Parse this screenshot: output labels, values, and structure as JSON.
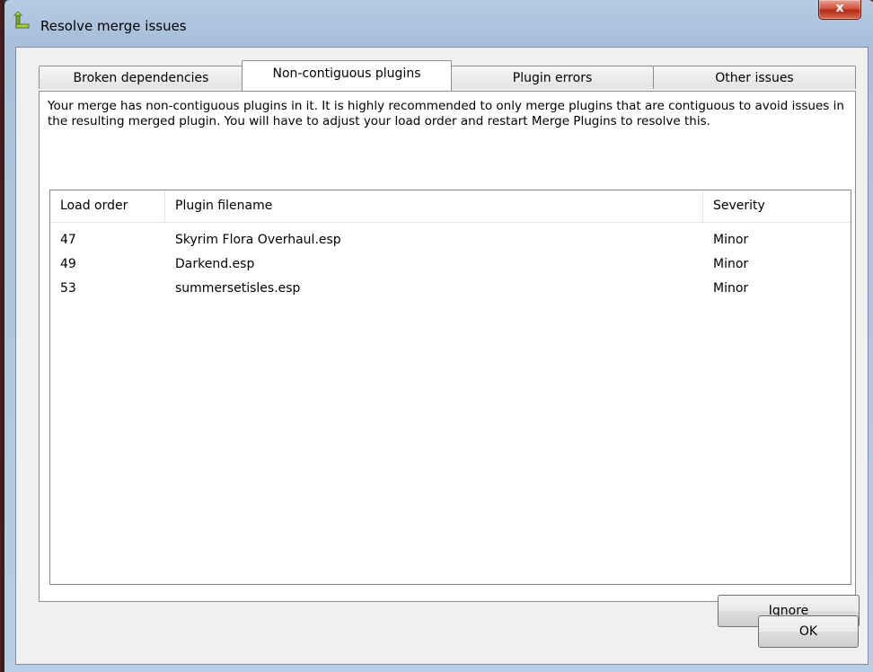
{
  "window": {
    "title": "Resolve merge issues",
    "close_label": "x"
  },
  "tabs": [
    {
      "label": "Broken dependencies",
      "active": false
    },
    {
      "label": "Non-contiguous plugins",
      "active": true
    },
    {
      "label": "Plugin errors",
      "active": false
    },
    {
      "label": "Other issues",
      "active": false
    }
  ],
  "panel": {
    "description": "Your merge has non-contiguous plugins in it.  It is highly recommended to only merge plugins that are contiguous to avoid issues in the resulting merged plugin.  You will have to adjust your load order and restart Merge Plugins to resolve this.",
    "columns": [
      "Load order",
      "Plugin filename",
      "Severity"
    ],
    "rows": [
      {
        "load_order": "47",
        "filename": "Skyrim Flora Overhaul.esp",
        "severity": "Minor"
      },
      {
        "load_order": "49",
        "filename": "Darkend.esp",
        "severity": "Minor"
      },
      {
        "load_order": "53",
        "filename": "summersetisles.esp",
        "severity": "Minor"
      }
    ],
    "ignore_label": "Ignore"
  },
  "ok_label": "OK",
  "colors": {
    "title_bar": "#b7cbe3",
    "close_button": "#c8412c"
  }
}
